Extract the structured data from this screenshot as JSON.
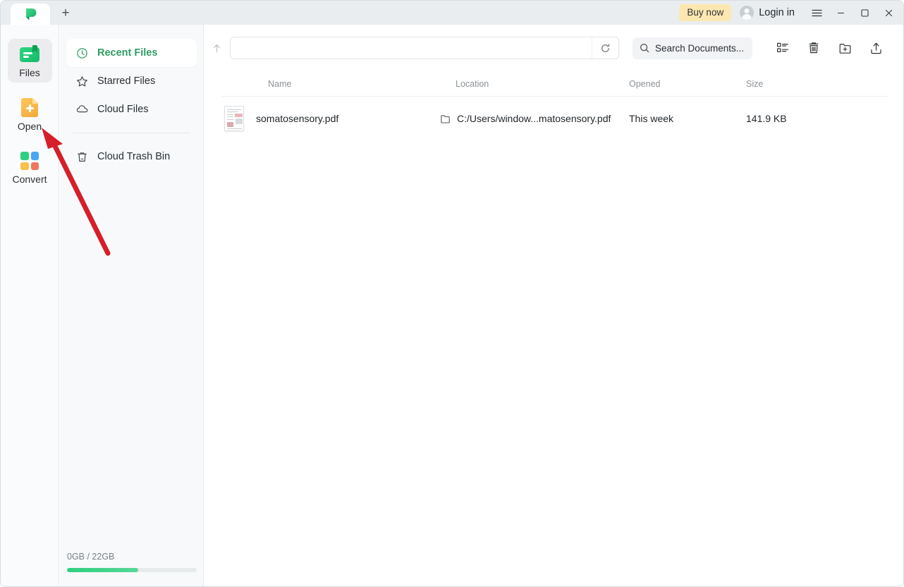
{
  "window": {
    "tab_logo_icon": "app-logo-green-leaf",
    "new_tab_label": "+",
    "buy_now_label": "Buy now",
    "login_label": "Login in",
    "menu_icon": "hamburger-menu-icon",
    "minimize_icon": "minimize-icon",
    "maximize_icon": "maximize-icon",
    "close_icon": "close-icon"
  },
  "rail": {
    "items": [
      {
        "label": "Files",
        "icon": "files-icon",
        "active": true
      },
      {
        "label": "Open",
        "icon": "open-file-icon",
        "active": false
      },
      {
        "label": "Convert",
        "icon": "convert-grid-icon",
        "active": false
      }
    ]
  },
  "sidebar": {
    "items": [
      {
        "label": "Recent Files",
        "icon": "clock-icon",
        "active": true
      },
      {
        "label": "Starred Files",
        "icon": "star-icon",
        "active": false
      },
      {
        "label": "Cloud Files",
        "icon": "cloud-icon",
        "active": false
      },
      {
        "label": "Cloud Trash Bin",
        "icon": "trash-icon",
        "active": false
      }
    ],
    "storage": {
      "label": "0GB / 22GB",
      "used_gb": 0,
      "total_gb": 22,
      "bar_fill_percent": 55,
      "bar_color": "#2ecf7f"
    }
  },
  "toolbar": {
    "back_icon": "up-arrow-icon",
    "address_value": "",
    "address_placeholder": "",
    "refresh_icon": "refresh-icon",
    "search_icon": "search-icon",
    "search_value": "",
    "search_placeholder": "Search Documents...",
    "view_toggle_icon": "list-view-icon",
    "trash_icon": "trash-bin-icon",
    "new_folder_icon": "new-folder-icon",
    "share_icon": "share-upload-icon"
  },
  "table": {
    "columns": [
      "Name",
      "Location",
      "Opened",
      "Size"
    ],
    "rows": [
      {
        "name": "somatosensory.pdf",
        "location": "C:/Users/window...matosensory.pdf",
        "opened": "This week",
        "size": "141.9 KB",
        "thumbnail_icon": "pdf-document-thumbnail",
        "folder_icon": "folder-icon"
      }
    ]
  },
  "annotation": {
    "arrow_color": "#d51f2a",
    "arrow_label": "red-arrow-pointing-to-open-button"
  },
  "theme": {
    "accent_green": "#2f9e63",
    "titlebar_bg": "#e9edef",
    "sidebar_bg": "#f7f9fa",
    "main_bg": "#ffffff",
    "buy_now_bg": "#fce7b0"
  }
}
